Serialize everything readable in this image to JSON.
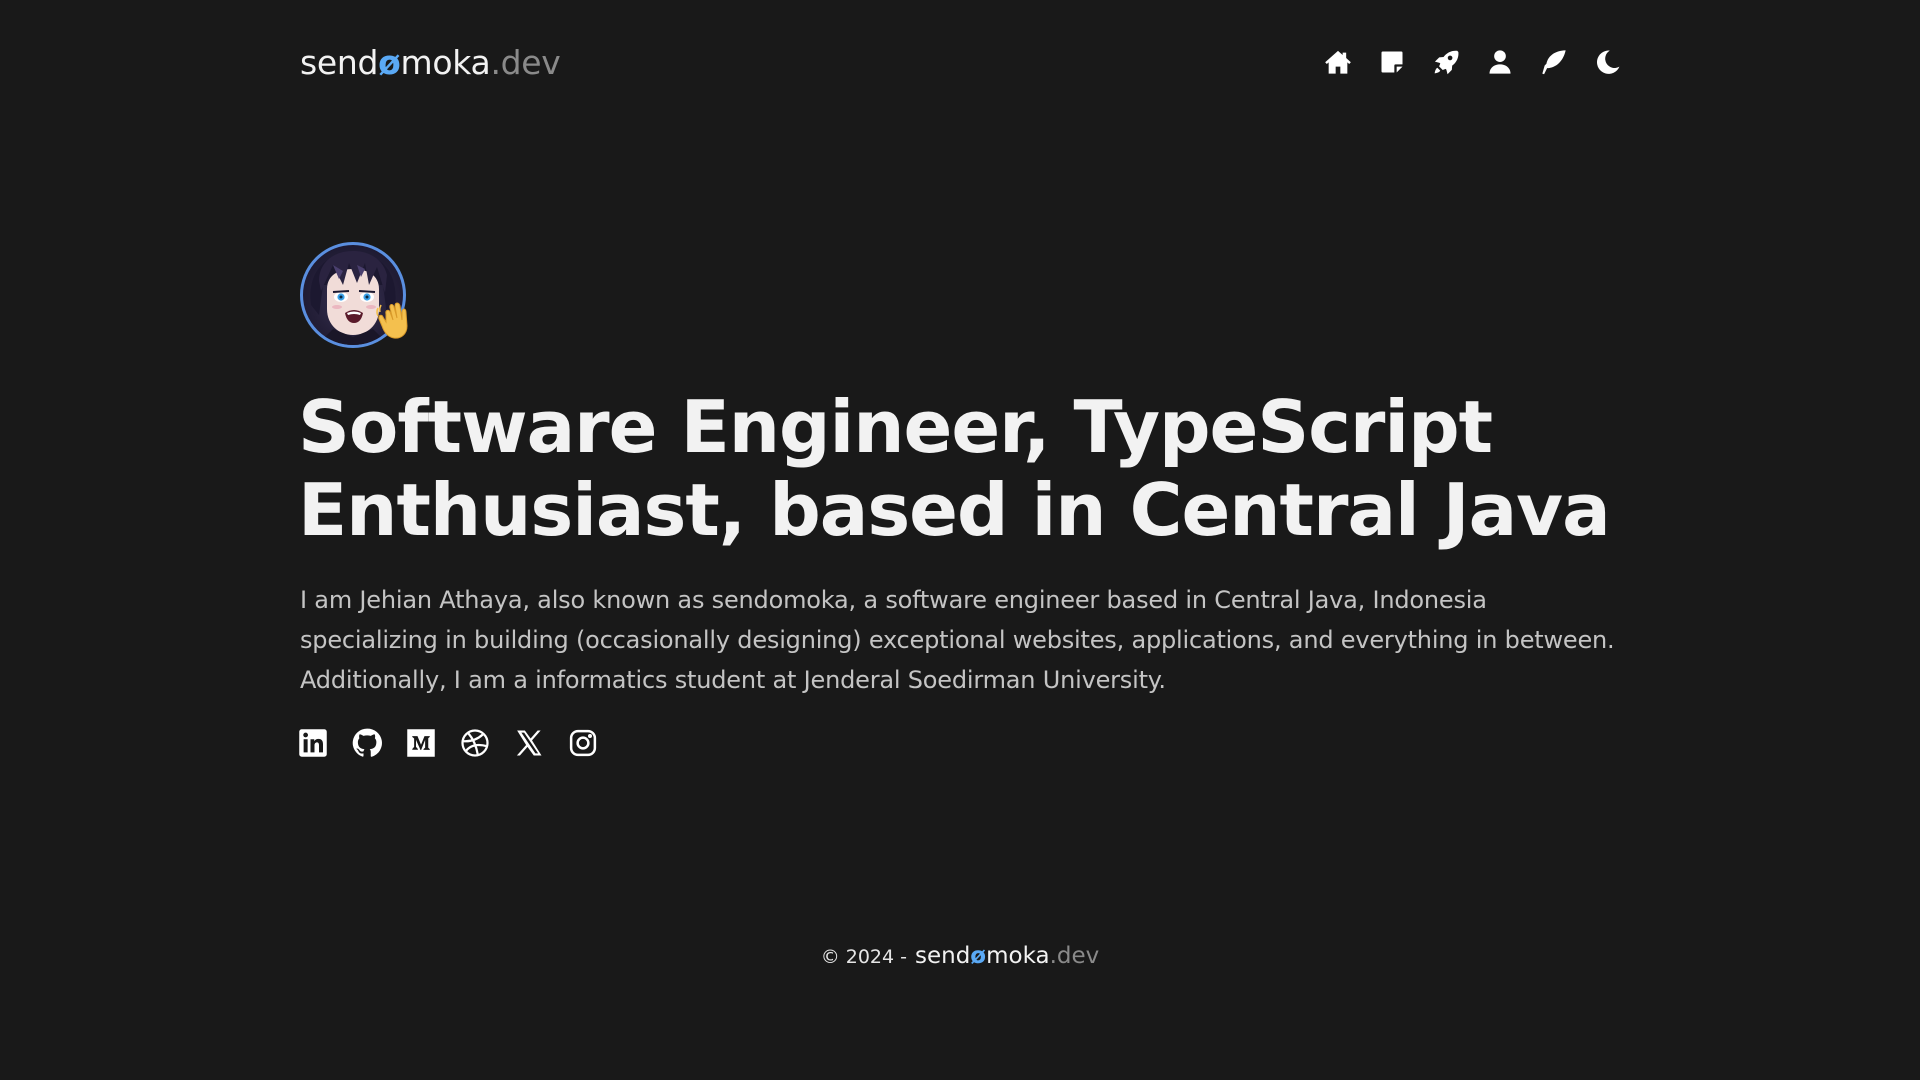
{
  "brand": {
    "name_prefix": "send",
    "name_accent": "ø",
    "name_suffix": "moka",
    "tld": ".dev",
    "accent_color": "#5aa9f5"
  },
  "nav": {
    "items": [
      {
        "icon": "home-icon",
        "label": "Home"
      },
      {
        "icon": "note-icon",
        "label": "Notes"
      },
      {
        "icon": "rocket-icon",
        "label": "Projects"
      },
      {
        "icon": "user-icon",
        "label": "About"
      },
      {
        "icon": "feather-icon",
        "label": "Blog"
      },
      {
        "icon": "moon-icon",
        "label": "Toggle theme"
      }
    ]
  },
  "hero": {
    "avatar_icon": "avatar-image",
    "wave_icon": "waving-hand-icon",
    "headline_line1": "Software Engineer, TypeScript",
    "headline_line2": "Enthusiast, based in Central Java",
    "intro": "I am Jehian Athaya, also known as sendomoka, a software engineer based in Central Java, Indonesia specializing in building (occasionally designing) exceptional websites, applications, and everything in between. Additionally, I am a informatics student at Jenderal Soedirman University."
  },
  "socials": [
    {
      "icon": "linkedin-icon"
    },
    {
      "icon": "github-icon"
    },
    {
      "icon": "medium-icon"
    },
    {
      "icon": "dribbble-icon"
    },
    {
      "icon": "x-icon"
    },
    {
      "icon": "instagram-icon"
    }
  ],
  "footer": {
    "copyright": "© 2024 -"
  },
  "colors": {
    "background": "#191919",
    "text": "#f2f2f2",
    "muted_text": "#c4c4c4",
    "tld": "#8a8a8a",
    "avatar_border": "#5a8fe0"
  }
}
